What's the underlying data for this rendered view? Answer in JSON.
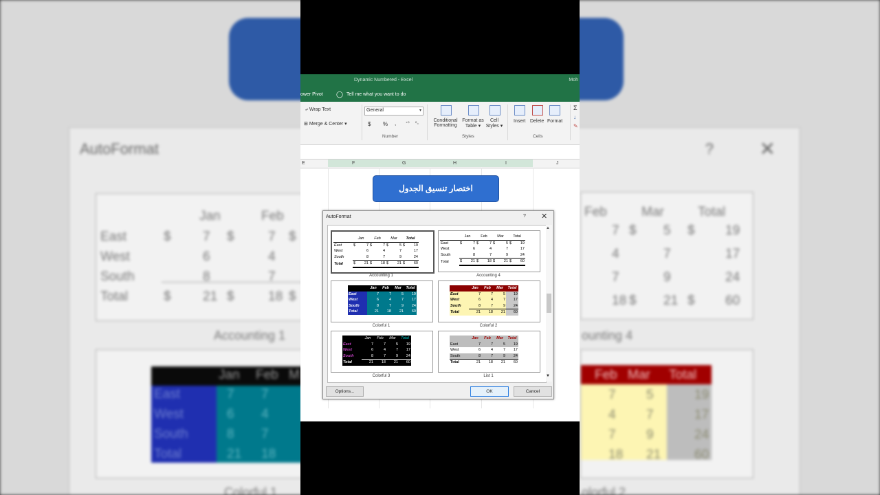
{
  "excel": {
    "doc_title": "Dynamic Numbered  -  Excel",
    "user": "Moh",
    "menu": {
      "power_pivot": "ower Pivot",
      "tell_me": "Tell me what you want to do"
    },
    "ribbon": {
      "wrap_text": "Wrap Text",
      "merge_center": "Merge & Center",
      "number_format": "General",
      "currency": "$",
      "percent": "%",
      "comma": ",",
      "group_number": "Number",
      "group_styles": "Styles",
      "group_cells": "Cells",
      "conditional_formatting_1": "Conditional",
      "conditional_formatting_2": "Formatting",
      "format_as_table_1": "Format as",
      "format_as_table_2": "Table",
      "cell_styles_1": "Cell",
      "cell_styles_2": "Styles",
      "insert": "Insert",
      "delete": "Delete",
      "format": "Format",
      "sigma": "Σ"
    },
    "columns": [
      "E",
      "F",
      "G",
      "H",
      "I",
      "J"
    ],
    "banner_text": "اختصار تنسيق الجدول"
  },
  "dialog": {
    "title": "AutoFormat",
    "help": "?",
    "close": "✕",
    "options_label": "Options...",
    "ok_label": "OK",
    "cancel_label": "Cancel",
    "formats": [
      {
        "name": "Accounting 1",
        "selected": true
      },
      {
        "name": "Accounting 4",
        "selected": false
      },
      {
        "name": "Colorful 1",
        "selected": false
      },
      {
        "name": "Colorful 2",
        "selected": false
      },
      {
        "name": "Colorful 3",
        "selected": false
      },
      {
        "name": "List 1",
        "selected": false
      }
    ],
    "sample": {
      "headers": [
        "Jan",
        "Feb",
        "Mar",
        "Total"
      ],
      "rows": [
        {
          "label": "East",
          "values": [
            "7",
            "7",
            "5",
            "19"
          ]
        },
        {
          "label": "West",
          "values": [
            "6",
            "4",
            "7",
            "17"
          ]
        },
        {
          "label": "South",
          "values": [
            "8",
            "7",
            "9",
            "24"
          ]
        },
        {
          "label": "Total",
          "values": [
            "21",
            "18",
            "21",
            "60"
          ]
        }
      ],
      "currency_symbol": "$"
    }
  },
  "background": {
    "dialog_title": "AutoFormat",
    "help": "?",
    "close": "✕",
    "captions": [
      "Accounting 1",
      "ounting 4",
      "Colorful 1",
      "olorful 2"
    ],
    "left_headers": [
      "Jan",
      "Feb"
    ],
    "right_headers": [
      "Feb",
      "Mar",
      "Total"
    ],
    "left_rows": [
      {
        "label": "East",
        "cells": [
          "$",
          "7",
          "$",
          "7",
          "$"
        ]
      },
      {
        "label": "West",
        "cells": [
          "6",
          "4"
        ]
      },
      {
        "label": "South",
        "cells": [
          "8",
          "7"
        ]
      },
      {
        "label": "Total",
        "cells": [
          "$",
          "21",
          "$",
          "18",
          "$"
        ]
      }
    ],
    "right_rows": [
      {
        "cells": [
          "7",
          "$",
          "5",
          "$",
          "19"
        ]
      },
      {
        "cells": [
          "4",
          "7",
          "17"
        ]
      },
      {
        "cells": [
          "7",
          "9",
          "24"
        ]
      },
      {
        "cells": [
          "18",
          "$",
          "21",
          "$",
          "60"
        ]
      }
    ],
    "colorful1_headers": [
      "Jan",
      "Feb",
      "M"
    ],
    "colorful1_rows": [
      {
        "label": "East",
        "cells": [
          "7",
          "7"
        ]
      },
      {
        "label": "West",
        "cells": [
          "6",
          "4"
        ]
      },
      {
        "label": "South",
        "cells": [
          "8",
          "7"
        ]
      },
      {
        "label": "Total",
        "cells": [
          "21",
          "18"
        ]
      }
    ],
    "colorful2_headers": [
      "Feb",
      "Mar",
      "Total"
    ],
    "colorful2_rows": [
      {
        "cells": [
          "7",
          "5",
          "19"
        ]
      },
      {
        "cells": [
          "4",
          "7",
          "17"
        ]
      },
      {
        "cells": [
          "7",
          "9",
          "24"
        ]
      },
      {
        "cells": [
          "18",
          "21",
          "60"
        ]
      }
    ]
  },
  "colors": {
    "excel_green": "#217346",
    "banner_blue": "#2f6fd0",
    "colorful1_bg": "#00798c",
    "colorful2_header": "#8b0000",
    "colorful2_body": "#fdf5b3"
  }
}
